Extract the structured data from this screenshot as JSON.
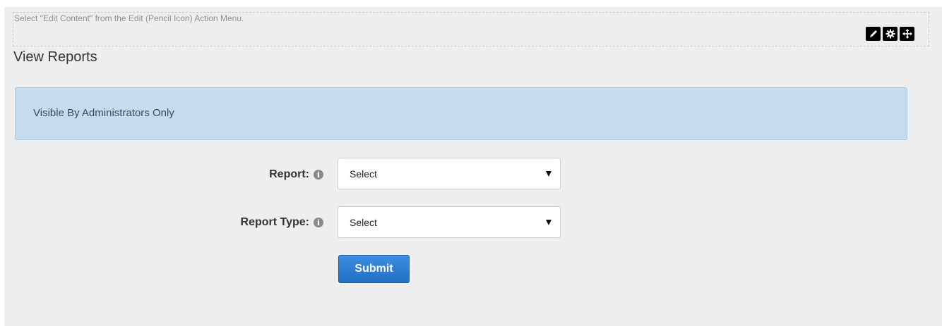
{
  "module": {
    "edit_hint": "Select \"Edit Content\" from the Edit (Pencil Icon) Action Menu.",
    "title": "View Reports",
    "action_icons": [
      "pencil-icon",
      "gear-icon",
      "move-icon"
    ]
  },
  "alert": {
    "text": "Visible By Administrators Only",
    "color": "#c4dcee"
  },
  "form": {
    "report": {
      "label": "Report:",
      "selected": "Select"
    },
    "report_type": {
      "label": "Report Type:",
      "selected": "Select"
    },
    "submit_label": "Submit"
  },
  "colors": {
    "background": "#eeeeee",
    "primary_button": "#2a7bd0"
  }
}
